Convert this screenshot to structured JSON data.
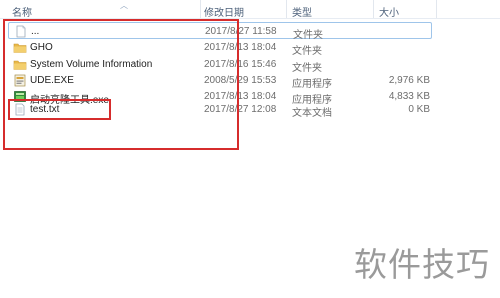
{
  "columns": {
    "name": "名称",
    "date": "修改日期",
    "type": "类型",
    "size": "大小"
  },
  "files": [
    {
      "name": "...",
      "date": "2017/8/27 11:58",
      "type": "文件夹",
      "size": "",
      "icon": "document-icon",
      "selected": true
    },
    {
      "name": "GHO",
      "date": "2017/8/13 18:04",
      "type": "文件夹",
      "size": "",
      "icon": "folder-icon"
    },
    {
      "name": "System Volume Information",
      "date": "2017/8/16 15:46",
      "type": "文件夹",
      "size": "",
      "icon": "folder-icon"
    },
    {
      "name": "UDE.EXE",
      "date": "2008/5/29 15:53",
      "type": "应用程序",
      "size": "2,976 KB",
      "icon": "application-icon"
    },
    {
      "name": "启动亮隆工具.exe",
      "date": "2017/8/13 18:04",
      "type": "应用程序",
      "size": "4,833 KB",
      "icon": "application-icon"
    },
    {
      "name": "test.txt",
      "date": "2017/8/27 12:08",
      "type": "文本文档",
      "size": "0 KB",
      "icon": "text-file-icon"
    }
  ],
  "watermark": "软件技巧",
  "colors": {
    "highlight_border": "#d62c2c",
    "selection_border": "#9fc5ea",
    "folder": "#e8b84a"
  }
}
